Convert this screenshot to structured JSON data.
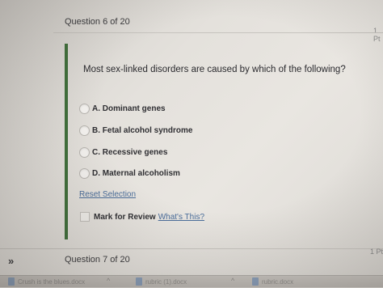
{
  "header": {
    "question_counter": "Question 6 of 20",
    "right_edge_top": "1 Pt"
  },
  "question": {
    "text": "Most sex-linked disorders are caused by which of the following?",
    "options": [
      {
        "label": "A. Dominant genes"
      },
      {
        "label": "B. Fetal alcohol syndrome"
      },
      {
        "label": "C. Recessive genes"
      },
      {
        "label": "D. Maternal alcoholism"
      }
    ],
    "reset_label": "Reset Selection",
    "review_label": "Mark for Review",
    "whats_this_label": "What's This?"
  },
  "footer": {
    "expand_icon": "»",
    "next_question": "Question 7 of 20",
    "right_edge_bottom": "1 Pt"
  },
  "downloads": [
    {
      "name": "Crush is the blues.docx"
    },
    {
      "name": "rubric (1).docx"
    },
    {
      "name": "rubric.docx"
    }
  ],
  "colors": {
    "accent_bar": "#3f6f3a",
    "link": "#4a6d9a"
  }
}
